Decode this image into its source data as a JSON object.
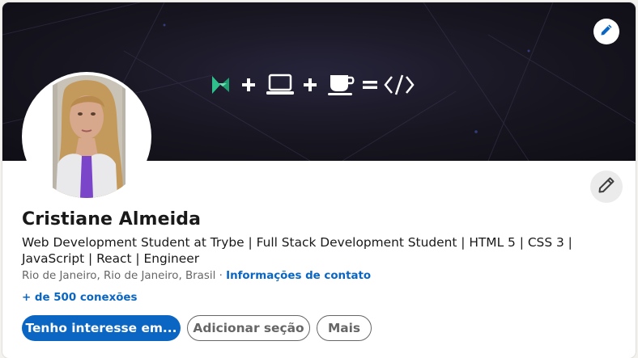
{
  "profile": {
    "name": "Cristiane Almeida",
    "headline": "Web Development Student at Trybe | Full Stack Development Student | HTML 5 | CSS 3 | JavaScript | React | Engineer",
    "location": "Rio de Janeiro, Rio de Janeiro, Brasil",
    "separator": "·",
    "contact_link": "Informações de contato",
    "connections": "+ de 500 conexões"
  },
  "actions": {
    "primary_label": "Tenho interesse em...",
    "add_section_label": "Adicionar seção",
    "more_label": "Mais"
  },
  "banner": {
    "formula_icons": [
      "trybe-logo-icon",
      "plus-icon",
      "laptop-icon",
      "plus-icon",
      "coffee-cup-icon",
      "equals-icon",
      "code-brackets-icon"
    ]
  },
  "colors": {
    "accent": "#0a66c2",
    "banner_bg": "#17151f",
    "trybe_green": "#2fc18c",
    "text_primary": "#191919",
    "text_secondary": "#666666"
  },
  "icons": {
    "banner_edit": "pencil-icon",
    "profile_edit": "pencil-icon"
  }
}
